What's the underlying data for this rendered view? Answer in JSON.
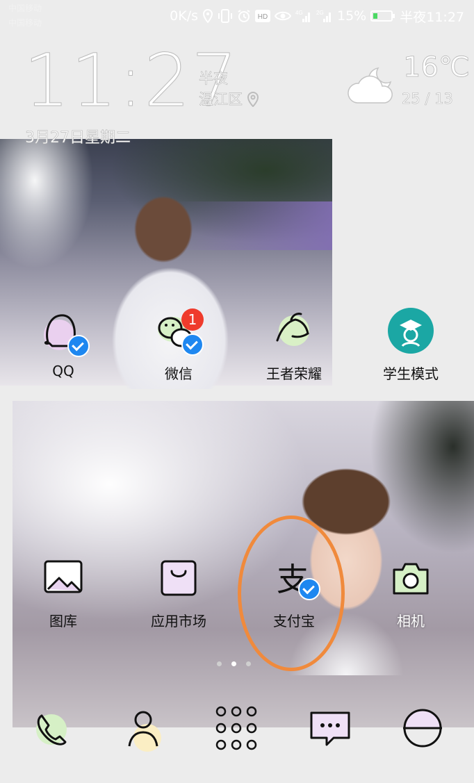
{
  "status_bar": {
    "carrier_1": "中国移动",
    "carrier_2": "中国移动",
    "net_speed": "0K/s",
    "battery_percent": "15%",
    "time": "半夜11:27",
    "icons": [
      "location-icon",
      "vibrate-icon",
      "alarm-icon",
      "hd-icon",
      "eye-icon",
      "signal-4g-icon",
      "signal-2g-icon",
      "battery-icon"
    ]
  },
  "lock_widget": {
    "time": "11:27",
    "period": "半夜",
    "location": "温江区",
    "temperature": "16℃",
    "temp_range": "25 / 13",
    "date": "3月27日星期二"
  },
  "apps_row1": [
    {
      "name": "QQ",
      "icon": "qq-icon",
      "verified": true
    },
    {
      "name": "微信",
      "icon": "wechat-icon",
      "verified": true,
      "badge": "1"
    },
    {
      "name": "王者荣耀",
      "icon": "game-icon"
    },
    {
      "name": "学生模式",
      "icon": "student-mode-icon"
    }
  ],
  "apps_row2": [
    {
      "name": "图库",
      "icon": "gallery-icon"
    },
    {
      "name": "应用市场",
      "icon": "app-market-icon"
    },
    {
      "name": "支付宝",
      "icon": "alipay-icon",
      "verified": true
    },
    {
      "name": "相机",
      "icon": "camera-icon"
    }
  ],
  "page_indicator": {
    "pages": 3,
    "active": 2
  },
  "dock": [
    "phone-icon",
    "contacts-icon",
    "app-drawer-icon",
    "messages-icon",
    "browser-icon"
  ],
  "colors": {
    "verify_blue": "#1e87f0",
    "badge_red": "#ef3b2c",
    "highlight_orange": "#f08a3c"
  }
}
